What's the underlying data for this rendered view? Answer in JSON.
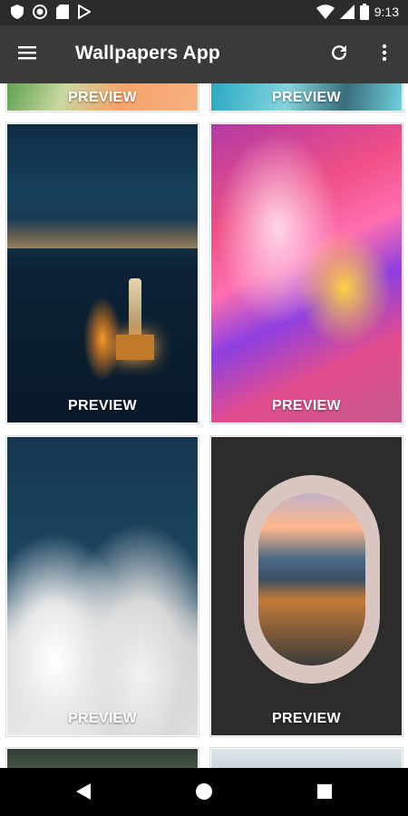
{
  "status_bar": {
    "time": "9:13",
    "icons": [
      "shield-icon",
      "record-icon",
      "sd-card-icon",
      "play-store-icon",
      "wifi-icon",
      "signal-icon",
      "battery-icon"
    ]
  },
  "app_bar": {
    "title": "Wallpapers App",
    "actions": [
      "menu-icon",
      "refresh-icon",
      "more-vert-icon"
    ]
  },
  "grid": {
    "preview_label": "PREVIEW",
    "items": [
      {
        "id": "top-left",
        "label": "PREVIEW",
        "colors": [
          "#5fa04d",
          "#f5a36a"
        ]
      },
      {
        "id": "top-right",
        "label": "PREVIEW",
        "colors": [
          "#2aa9c2",
          "#84d4dc"
        ]
      },
      {
        "id": "statue-of-liberty",
        "label": "PREVIEW",
        "colors": [
          "#0f2c44",
          "#ffae4a"
        ]
      },
      {
        "id": "fluid-art",
        "label": "PREVIEW",
        "colors": [
          "#ef4f86",
          "#ffd23f"
        ]
      },
      {
        "id": "clouds",
        "label": "PREVIEW",
        "colors": [
          "#15374f",
          "#ffffff"
        ]
      },
      {
        "id": "airplane-window",
        "label": "PREVIEW",
        "colors": [
          "#2c2c2c",
          "#ffb78c"
        ]
      },
      {
        "id": "bottom-left",
        "label": "",
        "colors": [
          "#2e3e34",
          "#6b7a56"
        ]
      },
      {
        "id": "bottom-right",
        "label": "",
        "colors": [
          "#dfe7ea",
          "#9fb7c1"
        ]
      }
    ]
  },
  "nav_bar": {
    "buttons": [
      "back-icon",
      "home-icon",
      "recents-icon"
    ]
  }
}
